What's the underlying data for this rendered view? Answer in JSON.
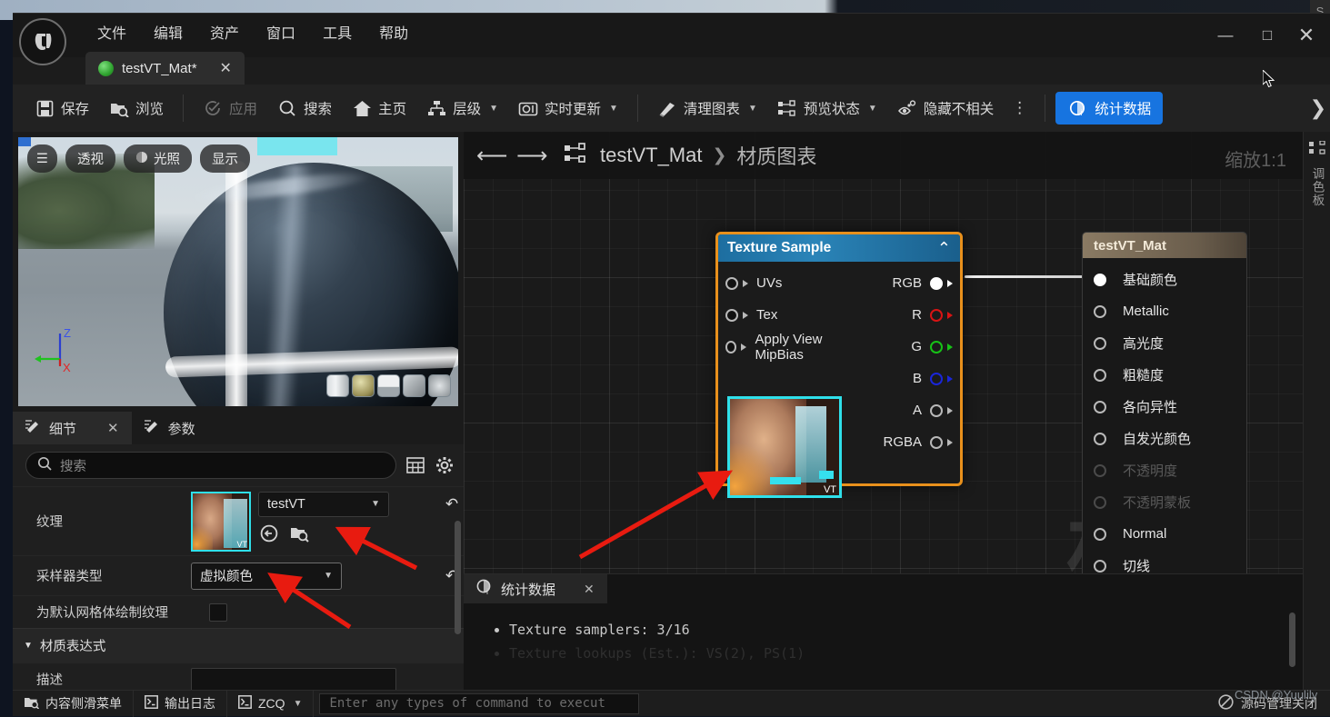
{
  "app": {
    "logo_glyph": "U",
    "menus": [
      "文件",
      "编辑",
      "资产",
      "窗口",
      "工具",
      "帮助"
    ],
    "window_controls": {
      "minimize": "—",
      "maximize": "□",
      "close": "✕"
    }
  },
  "tab": {
    "label": "testVT_Mat*",
    "close": "✕",
    "icon": "material-sphere-icon"
  },
  "toolbar": {
    "save": "保存",
    "browse": "浏览",
    "apply": "应用",
    "search": "搜索",
    "home": "主页",
    "hierarchy": "层级",
    "live_update": "实时更新",
    "clean_graph": "清理图表",
    "preview_state": "预览状态",
    "hide_unrelated": "隐藏不相关",
    "overflow": "⋮",
    "stats": "统计数据",
    "chevron": "❯"
  },
  "viewport": {
    "menu_glyph": "☰",
    "perspective": "透视",
    "lighting": "光照",
    "show": "显示",
    "axis_z": "Z",
    "axis_x": "X",
    "shapes": [
      "cylinder",
      "sphere",
      "plane",
      "cube",
      "teapot"
    ]
  },
  "details": {
    "tabs": [
      {
        "label": "细节",
        "active": true,
        "close": "✕"
      },
      {
        "label": "参数",
        "active": false,
        "close": ""
      }
    ],
    "search_placeholder": "搜索",
    "grid_icon": "table-view-icon",
    "gear_icon": "settings-gear-icon",
    "rows": [
      {
        "label": "纹理",
        "type": "asset",
        "value": "testVT",
        "revert": "↶"
      },
      {
        "label": "采样器类型",
        "type": "combo",
        "value": "虚拟颜色",
        "revert": "↶"
      },
      {
        "label": "为默认网格体绘制纹理",
        "type": "checkbox",
        "value": ""
      }
    ],
    "section": "材质表达式",
    "desc_label": "描述",
    "desc_value": ""
  },
  "graph": {
    "back_arrow": "⟵",
    "forward_arrow": "⟶",
    "breadcrumb_root": "testVT_Mat",
    "breadcrumb_sep": "❯",
    "breadcrumb_leaf": "材质图表",
    "zoom": "缩放1:1",
    "watermark": "材质"
  },
  "texture_node": {
    "title": "Texture Sample",
    "collapse": "⌃",
    "inputs": [
      "UVs",
      "Tex",
      "Apply View MipBias"
    ],
    "outputs": [
      {
        "label": "RGB",
        "color": "#ffffff",
        "filled": true
      },
      {
        "label": "R",
        "color": "#d81414",
        "filled": false
      },
      {
        "label": "G",
        "color": "#17c117",
        "filled": false
      },
      {
        "label": "B",
        "color": "#1a26d8",
        "filled": false
      },
      {
        "label": "A",
        "color": "#b9b9b9",
        "filled": false
      },
      {
        "label": "RGBA",
        "color": "#b9b9b9",
        "filled": false
      }
    ],
    "thumb_badge": "VT"
  },
  "material_node": {
    "title": "testVT_Mat",
    "pins": [
      {
        "label": "基础颜色",
        "connected": true,
        "dim": false
      },
      {
        "label": "Metallic",
        "connected": false,
        "dim": false
      },
      {
        "label": "高光度",
        "connected": false,
        "dim": false
      },
      {
        "label": "粗糙度",
        "connected": false,
        "dim": false
      },
      {
        "label": "各向异性",
        "connected": false,
        "dim": false
      },
      {
        "label": "自发光颜色",
        "connected": false,
        "dim": false
      },
      {
        "label": "不透明度",
        "connected": false,
        "dim": true
      },
      {
        "label": "不透明蒙板",
        "connected": false,
        "dim": true
      },
      {
        "label": "Normal",
        "connected": false,
        "dim": false
      },
      {
        "label": "切线",
        "connected": false,
        "dim": false
      }
    ]
  },
  "stats_panel": {
    "tab_label": "统计数据",
    "close": "✕",
    "lines": [
      "Texture samplers: 3/16",
      "Texture lookups (Est.): VS(2), PS(1)"
    ]
  },
  "right_strip": {
    "icon": "graph-node-icon",
    "label": "调色板"
  },
  "statusbar": {
    "content_drawer": "内容侧滑菜单",
    "output_log": "输出日志",
    "cmd_console": "ZCQ",
    "cmd_placeholder": "Enter any types of command to execut",
    "source_control": "源码管理关闭",
    "source_control_icon": "no-entry-icon",
    "watermark": "CSDN @Yuulily"
  },
  "colors": {
    "accent_blue": "#1774e0",
    "node_border_selected": "#e8901c",
    "thumb_border": "#2fe0ea",
    "annotation_red": "#e81b10"
  }
}
